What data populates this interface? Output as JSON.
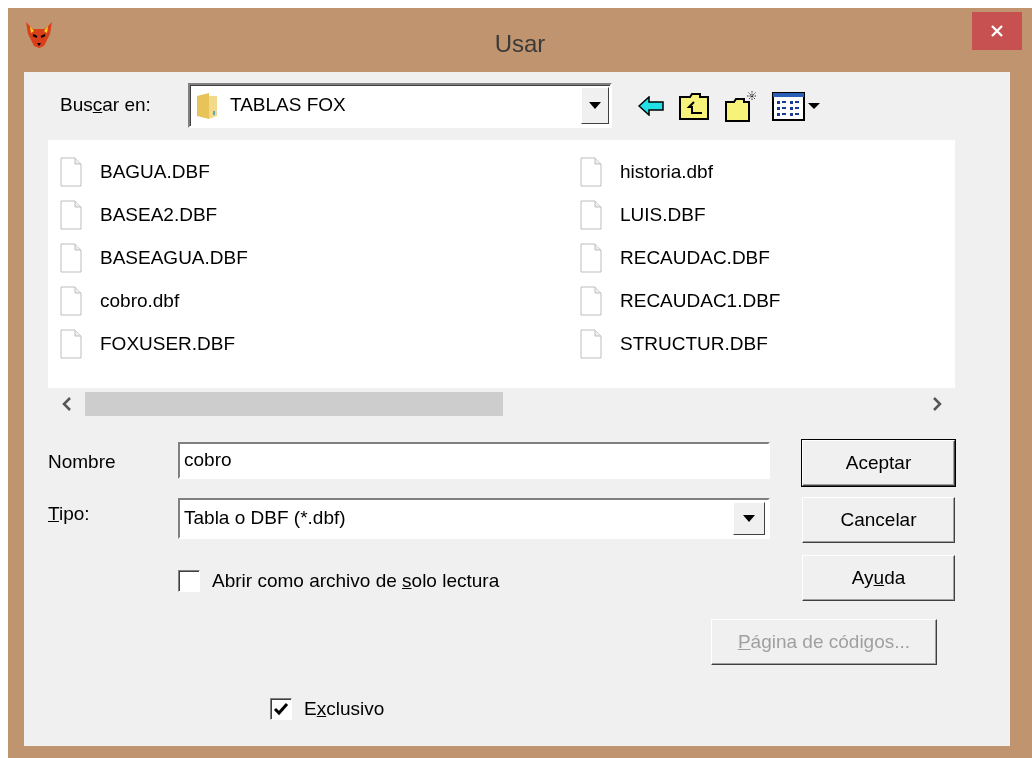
{
  "window": {
    "title": "Usar"
  },
  "look_in": {
    "label": [
      {
        "text": "Bus",
        "underline": false
      },
      {
        "text": "c",
        "underline": true
      },
      {
        "text": "ar en:",
        "underline": false
      }
    ],
    "value": "TABLAS FOX"
  },
  "files": [
    {
      "name": "BAGUA.DBF"
    },
    {
      "name": "BASEA2.DBF"
    },
    {
      "name": "BASEAGUA.DBF"
    },
    {
      "name": "cobro.dbf"
    },
    {
      "name": "FOXUSER.DBF"
    },
    {
      "name": "historia.dbf"
    },
    {
      "name": "LUIS.DBF"
    },
    {
      "name": "RECAUDAC.DBF"
    },
    {
      "name": "RECAUDAC1.DBF"
    },
    {
      "name": "STRUCTUR.DBF"
    }
  ],
  "name_field": {
    "label": [
      {
        "text": "Nombre",
        "underline": false
      }
    ],
    "value": "cobro"
  },
  "type_field": {
    "label": [
      {
        "text": "T",
        "underline": true
      },
      {
        "text": "ipo:",
        "underline": false
      }
    ],
    "value": "Tabla o DBF (*.dbf)"
  },
  "read_only": {
    "label": [
      {
        "text": "Abrir como archivo de ",
        "underline": false
      },
      {
        "text": "s",
        "underline": true
      },
      {
        "text": "olo lectura",
        "underline": false
      }
    ],
    "checked": false
  },
  "buttons": [
    {
      "label": [
        {
          "text": "Aceptar",
          "underline": false
        }
      ],
      "default": true,
      "disabled": false
    },
    {
      "label": [
        {
          "text": "Cancelar",
          "underline": false
        }
      ],
      "default": false,
      "disabled": false
    },
    {
      "label": [
        {
          "text": "Ay",
          "underline": false
        },
        {
          "text": "u",
          "underline": true
        },
        {
          "text": "da",
          "underline": false
        }
      ],
      "default": false,
      "disabled": false
    },
    {
      "label": [
        {
          "text": "P",
          "underline": true
        },
        {
          "text": "ágina de códigos...",
          "underline": false
        }
      ],
      "default": false,
      "disabled": true
    }
  ],
  "exclusive": {
    "label": [
      {
        "text": "E",
        "underline": false
      },
      {
        "text": "x",
        "underline": true
      },
      {
        "text": "clusivo",
        "underline": false
      }
    ],
    "checked": true
  }
}
